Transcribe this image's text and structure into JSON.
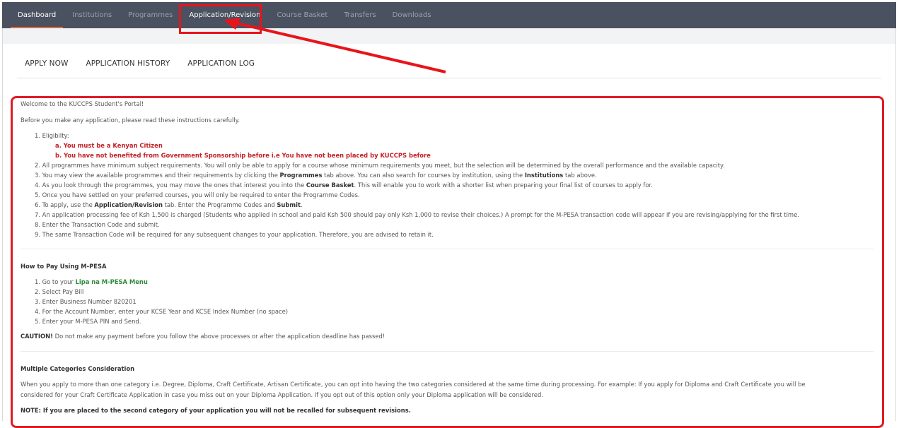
{
  "nav": {
    "items": [
      "Dashboard",
      "Institutions",
      "Programmes",
      "Application/Revision",
      "Course Basket",
      "Transfers",
      "Downloads"
    ]
  },
  "subtabs": [
    "APPLY NOW",
    "APPLICATION HISTORY",
    "APPLICATION LOG"
  ],
  "intro": {
    "welcome": "Welcome to the KUCCPS Student's Portal!",
    "before": "Before you make any application, please read these instructions carefully.",
    "i1": "1. Eligibilty:",
    "i1a": "a. You must be a Kenyan Citizen",
    "i1b": "b. You have not benefited from Government Sponsorship before i.e You have not been placed by KUCCPS before",
    "i2": "2. All programmes have minimum subject requirements. You will only be able to apply for a course whose minimum requirements you meet, but the selection will be determined by the overall performance and the available capacity.",
    "i3_pre": "3. You may view the available programmes and their requirements by clicking the ",
    "i3_b1": "Programmes",
    "i3_mid": " tab above. You can also search for courses by institution, using the ",
    "i3_b2": "Institutions",
    "i3_post": " tab above.",
    "i4_pre": "4. As you look through the programmes, you may move the ones that interest you into the ",
    "i4_b": "Course Basket",
    "i4_post": ". This will enable you to work with a shorter list when preparing your final list of courses to apply for.",
    "i5": "5. Once you have settled on your preferred courses, you will only be required to enter the Programme Codes.",
    "i6_pre": "6. To apply, use the ",
    "i6_b1": "Application/Revision",
    "i6_mid": " tab. Enter the Programme Codes and ",
    "i6_b2": "Submit",
    "i6_post": ".",
    "i7": "7. An application processing fee of Ksh 1,500 is charged (Students who applied in school and paid Ksh 500 should pay only Ksh 1,000 to revise their choices.) A prompt for the M-PESA transaction code will appear if you are revising/applying for the first time.",
    "i8": "8. Enter the Transaction Code and submit.",
    "i9": "9. The same Transaction Code will be required for any subsequent changes to your application. Therefore, you are advised to retain it."
  },
  "mpesa": {
    "heading": "How to Pay Using M-PESA",
    "s1_pre": "1. Go to your ",
    "s1_link": "Lipa na M-PESA Menu",
    "s2": "2. Select Pay Bill",
    "s3": "3. Enter Business Number 820201",
    "s4": "4. For the Account Number, enter your KCSE Year and KCSE Index Number (no space)",
    "s5": "5. Enter your M-PESA PIN and Send.",
    "caution_b": "CAUTION!",
    "caution": " Do not make any payment before you follow the above processes or after the application deadline has passed!"
  },
  "multi": {
    "heading": "Multiple Categories Consideration",
    "line1": "When you apply to more than one category i.e. Degree, Diploma, Craft Certificate, Artisan Certificate, you can opt into having the two categories considered at the same time during processing. For example: If you apply for Diploma and Craft Certificate you will be",
    "line2": "considered for your Craft Certificate Application in case you miss out on your Diploma Application. If you opt out of this option only your Diploma application will be considered.",
    "note": "NOTE: If you are placed to the second category of your application you will not be recalled for subsequent revisions."
  },
  "colors": {
    "topbar": "#4a5160",
    "annotation_red": "#e8141b",
    "eligibility_red": "#c42127",
    "lipa_green": "#2e8b3a"
  }
}
